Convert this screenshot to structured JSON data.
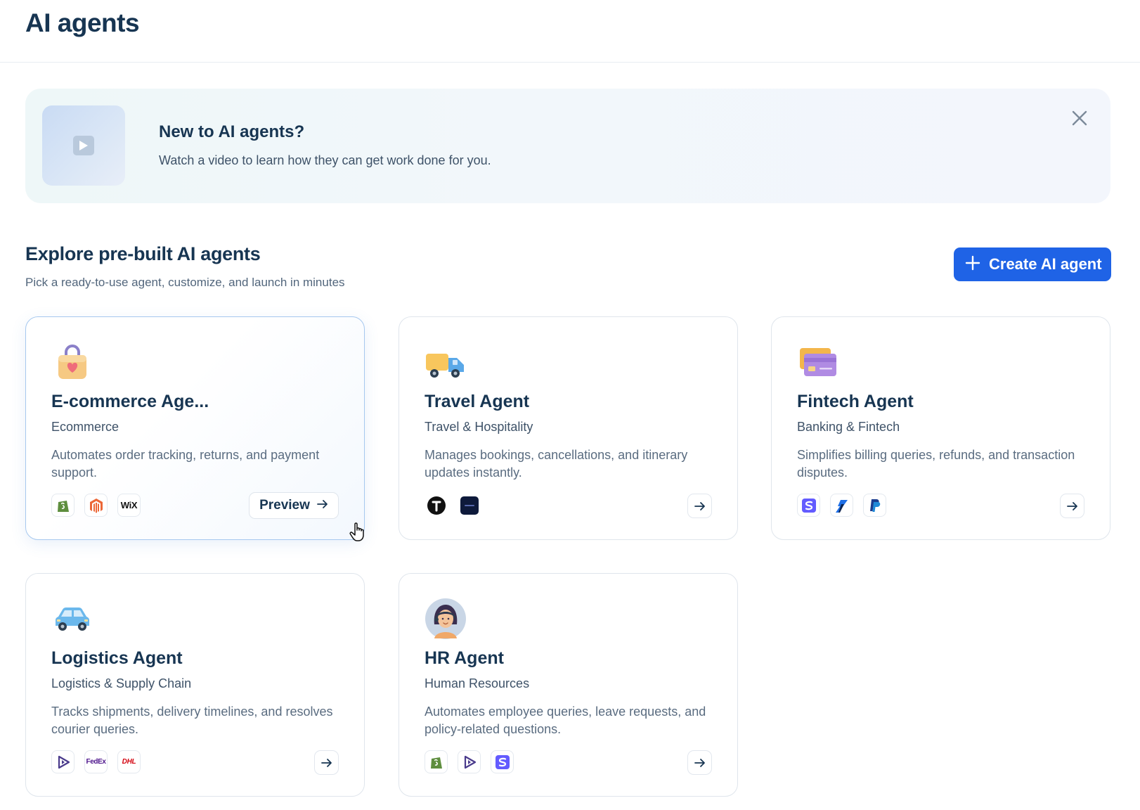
{
  "page": {
    "title": "AI agents"
  },
  "banner": {
    "title": "New to AI agents?",
    "subtitle": "Watch a video to learn how they can get work done for you.",
    "close_icon": "close-icon",
    "thumb_icon": "play-icon"
  },
  "section": {
    "title": "Explore pre-built AI agents",
    "subtitle": "Pick a ready-to-use agent, customize, and launch in minutes"
  },
  "create_button": {
    "label": "Create AI agent",
    "icon": "plus-icon",
    "color": "#1f63e6"
  },
  "cards": [
    {
      "name": "E-commerce Age...",
      "category": "Ecommerce",
      "description": "Automates order tracking, returns, and payment support.",
      "icon": "shopping-bag-icon",
      "integrations": [
        "shopify-icon",
        "magento-icon",
        "wix-icon"
      ],
      "wix_text": "WiX",
      "action_label": "Preview"
    },
    {
      "name": "Travel Agent",
      "category": "Travel & Hospitality",
      "description": "Manages bookings, cancellations, and itinerary updates instantly.",
      "icon": "delivery-truck-icon",
      "integrations": [
        "tripadvisor-icon",
        "dark-app-icon"
      ]
    },
    {
      "name": "Fintech Agent",
      "category": "Banking & Fintech",
      "description": "Simplifies billing queries, refunds, and transaction disputes.",
      "icon": "credit-card-icon",
      "integrations": [
        "stripe-icon",
        "razorpay-icon",
        "paypal-icon"
      ]
    },
    {
      "name": "Logistics Agent",
      "category": "Logistics & Supply Chain",
      "description": "Tracks shipments, delivery timelines, and resolves courier queries.",
      "icon": "car-icon",
      "integrations": [
        "play-logo-icon",
        "fedex-icon",
        "dhl-icon"
      ],
      "fedex_text": "FedEx",
      "dhl_text": "DHL"
    },
    {
      "name": "HR Agent",
      "category": "Human Resources",
      "description": "Automates employee queries, leave requests, and policy-related questions.",
      "icon": "support-person-icon",
      "integrations": [
        "shopify-icon",
        "play-logo-icon",
        "stripe-icon"
      ]
    }
  ]
}
